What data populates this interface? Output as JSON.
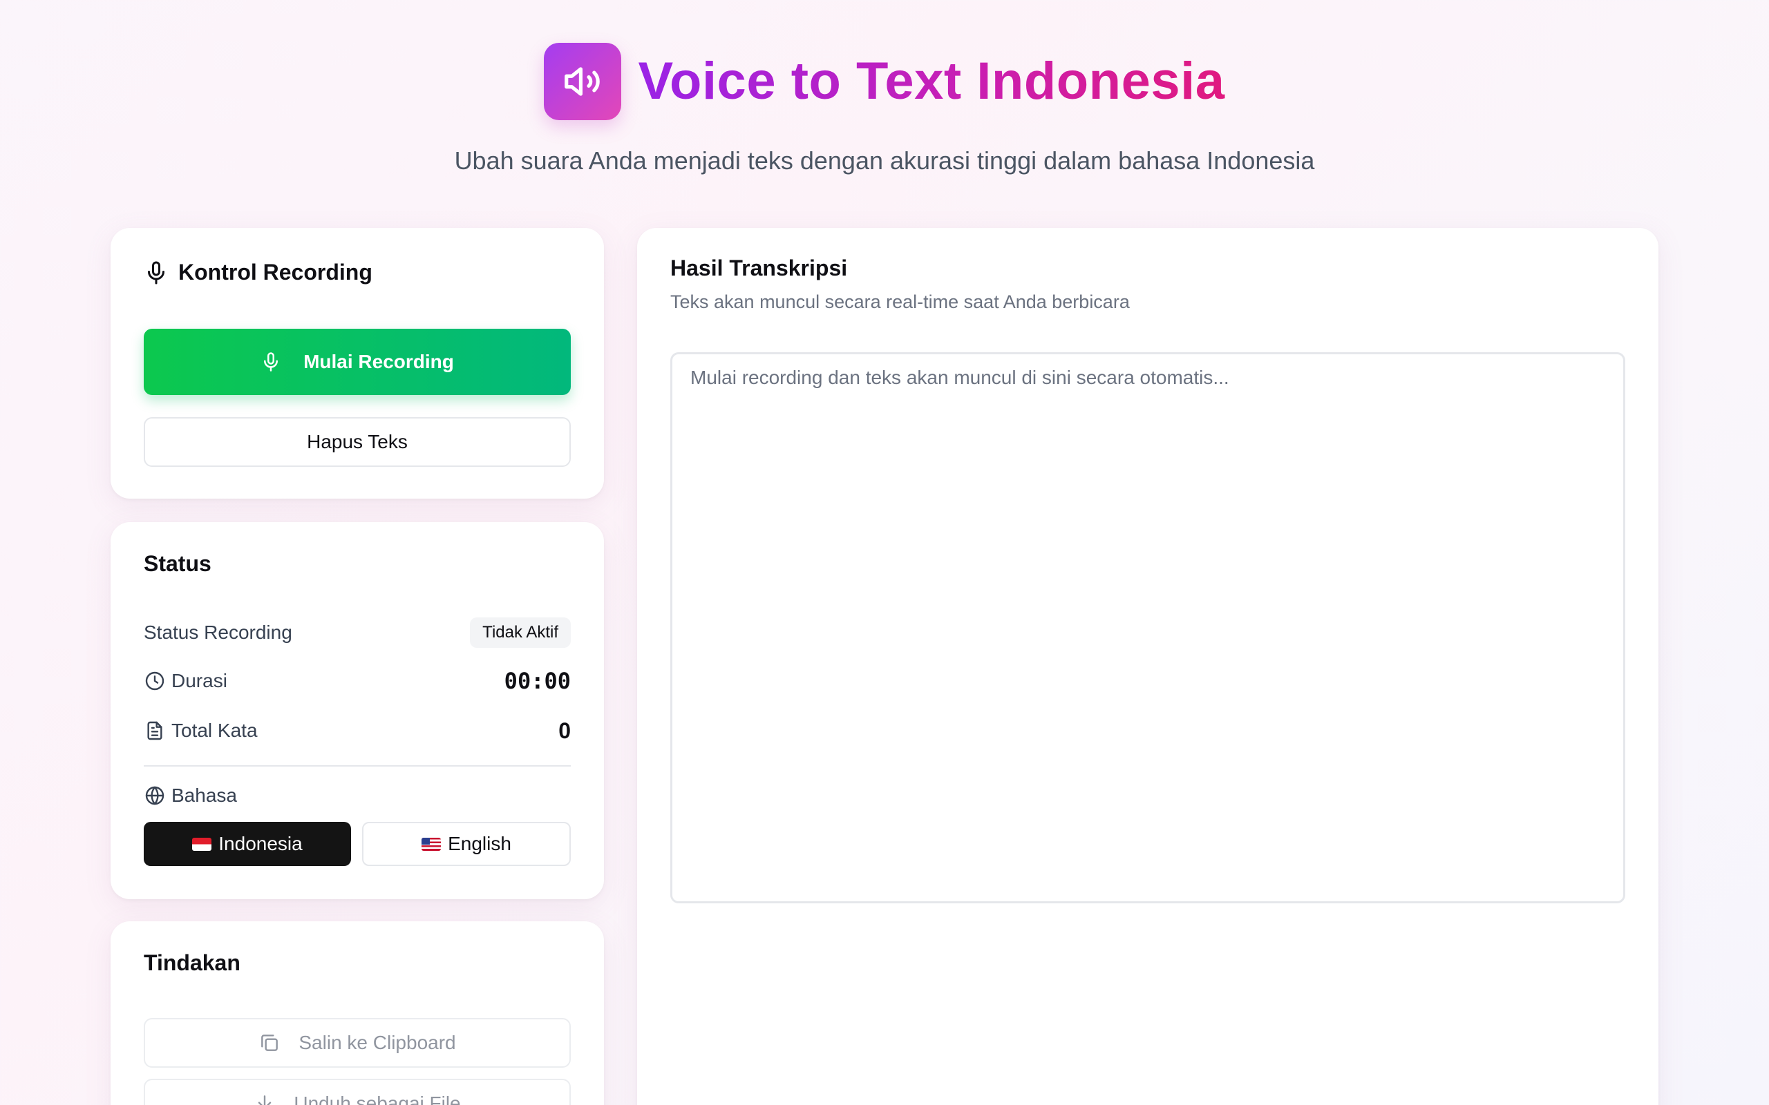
{
  "header": {
    "title": "Voice to Text Indonesia",
    "subtitle": "Ubah suara Anda menjadi teks dengan akurasi tinggi dalam bahasa Indonesia",
    "logo_icon": "speaker-wave-icon"
  },
  "recording_card": {
    "title": "Kontrol Recording",
    "title_icon": "microphone-icon",
    "start_label": "Mulai Recording",
    "clear_label": "Hapus Teks"
  },
  "status_card": {
    "title": "Status",
    "recording_status_label": "Status Recording",
    "recording_status_value": "Tidak Aktif",
    "duration_label": "Durasi",
    "duration_value": "00:00",
    "word_count_label": "Total Kata",
    "word_count_value": "0",
    "language_label": "Bahasa",
    "languages": [
      {
        "label": "Indonesia",
        "flag": "flag-id",
        "selected": true
      },
      {
        "label": "English",
        "flag": "flag-us",
        "selected": false
      }
    ]
  },
  "actions_card": {
    "title": "Tindakan",
    "copy_label": "Salin ke Clipboard",
    "download_label": "Unduh sebagai File"
  },
  "transcript_card": {
    "title": "Hasil Transkripsi",
    "subtitle": "Teks akan muncul secara real-time saat Anda berbicara",
    "placeholder": "Mulai recording dan teks akan muncul di sini secara otomatis...",
    "value": ""
  },
  "colors": {
    "accent_purple": "#9a23e6",
    "accent_pink": "#e0197f",
    "record_green": "#0cc84e",
    "dark": "#141414"
  }
}
